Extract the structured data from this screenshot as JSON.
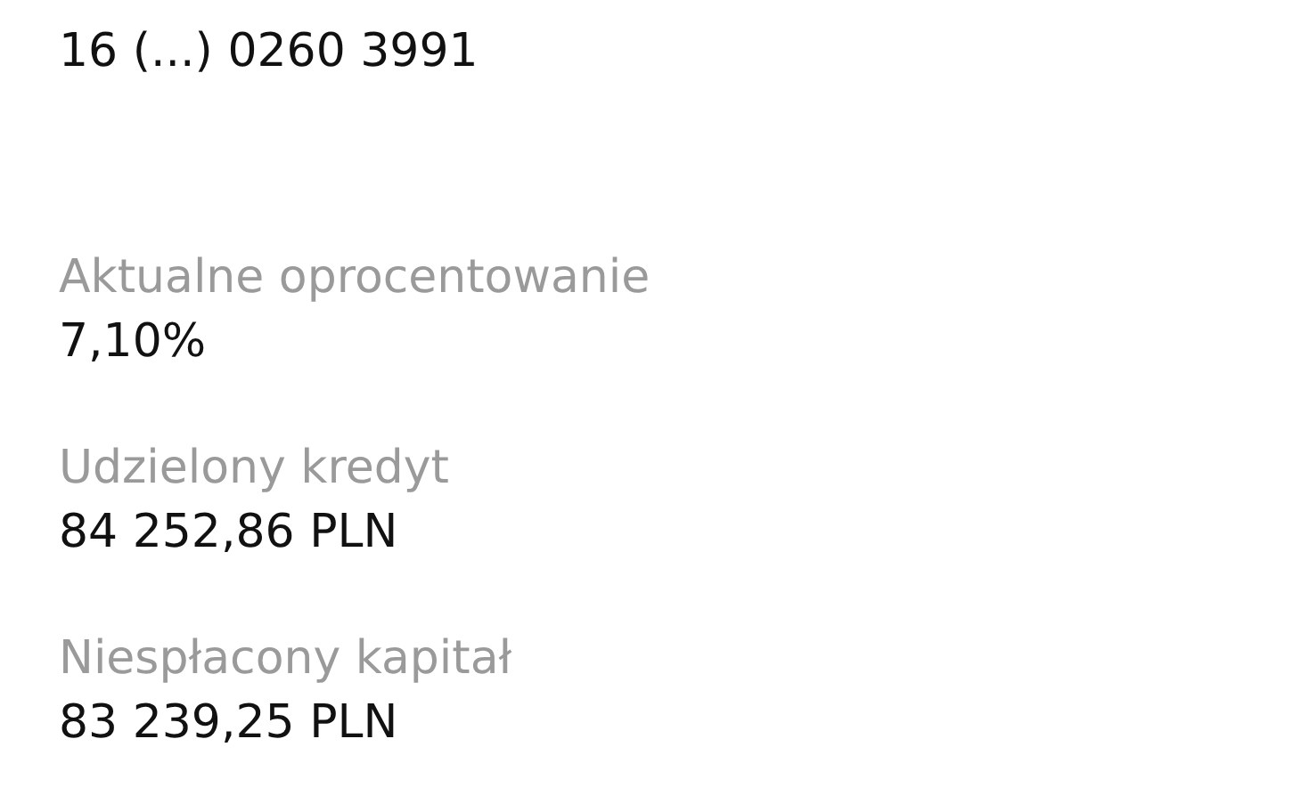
{
  "account": {
    "number": "16 (...) 0260 3991"
  },
  "details": [
    {
      "label": "Aktualne oprocentowanie",
      "value": "7,10%"
    },
    {
      "label": "Udzielony kredyt",
      "value": "84 252,86 PLN"
    },
    {
      "label": "Niespłacony kapitał",
      "value": "83 239,25 PLN"
    }
  ]
}
